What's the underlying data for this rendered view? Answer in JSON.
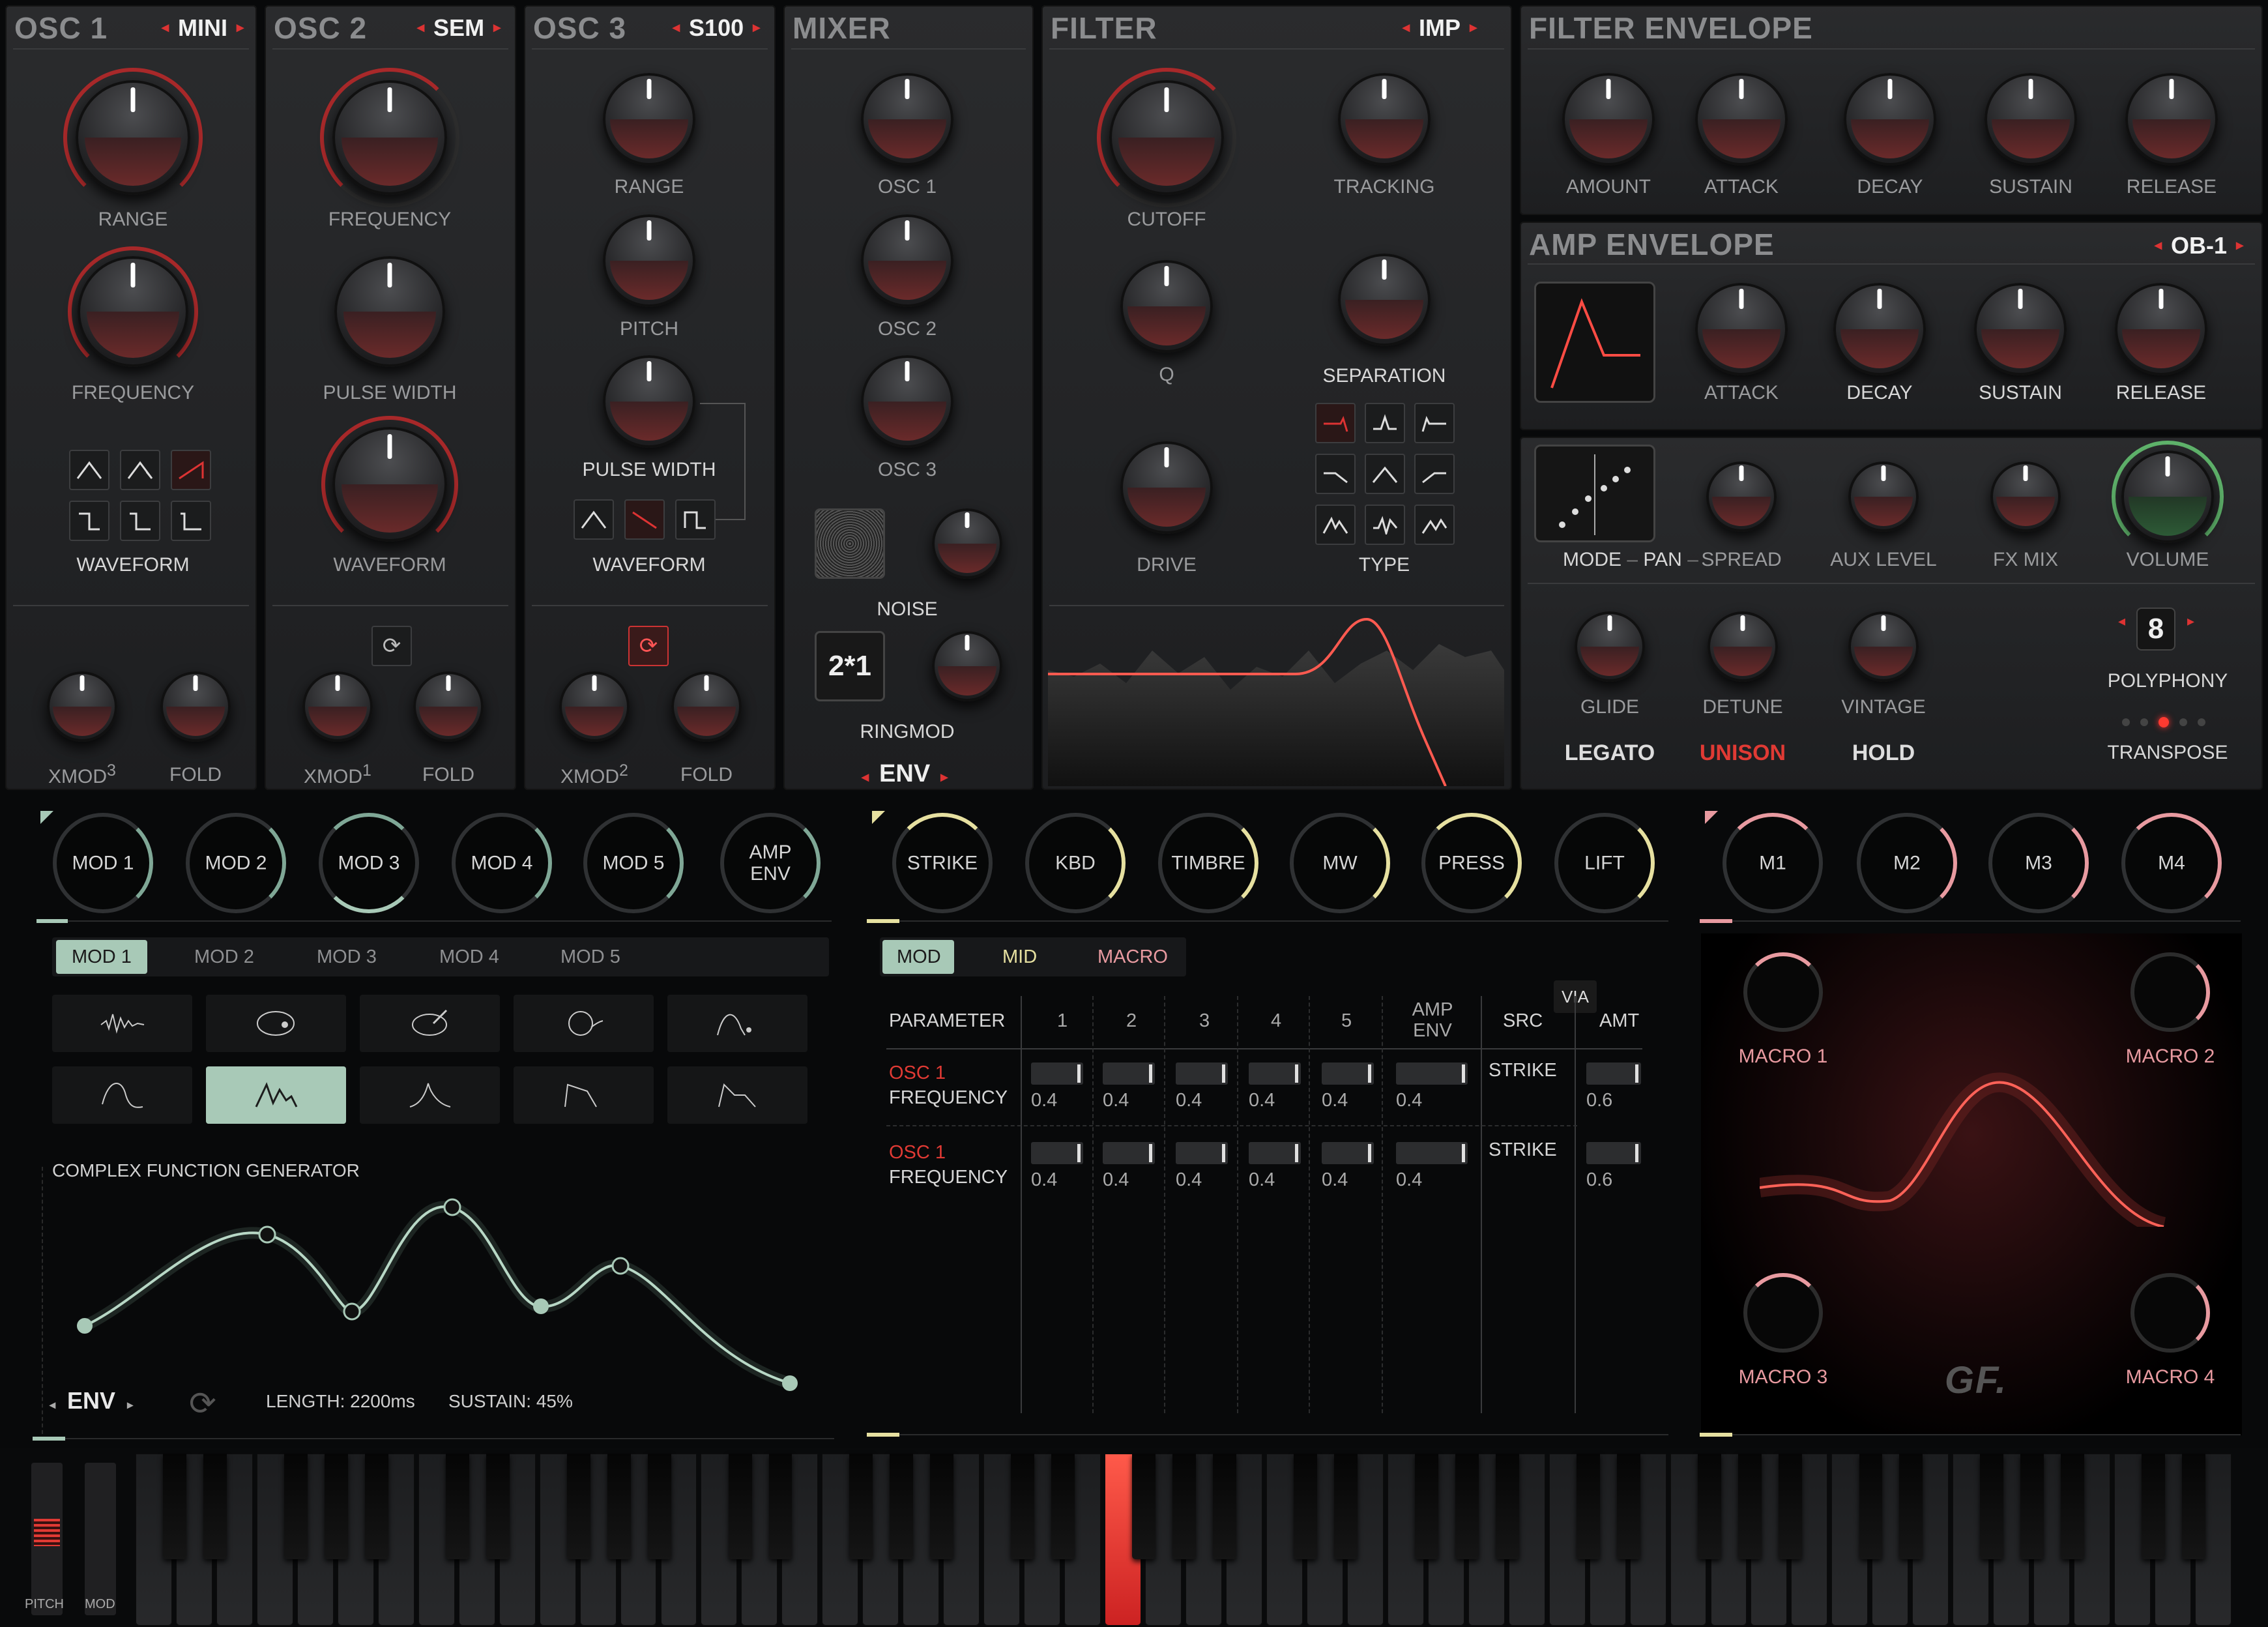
{
  "osc1": {
    "title": "OSC 1",
    "model": "MINI",
    "range": "RANGE",
    "frequency": "FREQUENCY",
    "waveform": "WAVEFORM",
    "xmod": "XMOD",
    "xmod_sup": "3",
    "fold": "FOLD"
  },
  "osc2": {
    "title": "OSC 2",
    "model": "SEM",
    "frequency": "FREQUENCY",
    "pulse_width": "PULSE WIDTH",
    "waveform": "WAVEFORM",
    "xmod": "XMOD",
    "xmod_sup": "1",
    "fold": "FOLD"
  },
  "osc3": {
    "title": "OSC 3",
    "model": "S100",
    "range": "RANGE",
    "pitch": "PITCH",
    "pulse_width": "PULSE WIDTH",
    "waveform": "WAVEFORM",
    "xmod": "XMOD",
    "xmod_sup": "2",
    "fold": "FOLD"
  },
  "mixer": {
    "title": "MIXER",
    "osc1": "OSC 1",
    "osc2": "OSC 2",
    "osc3": "OSC 3",
    "noise": "NOISE",
    "ringmod": "RINGMOD",
    "ringmod_value": "2*1",
    "env": "ENV"
  },
  "filter": {
    "title": "FILTER",
    "model": "IMP",
    "cutoff": "CUTOFF",
    "tracking": "TRACKING",
    "q": "Q",
    "separation": "SEPARATION",
    "drive": "DRIVE",
    "type": "TYPE"
  },
  "filter_env": {
    "title": "FILTER ENVELOPE",
    "labels": [
      "AMOUNT",
      "ATTACK",
      "DECAY",
      "SUSTAIN",
      "RELEASE"
    ]
  },
  "amp_env": {
    "title": "AMP ENVELOPE",
    "model": "OB-1",
    "labels": [
      "ATTACK",
      "DECAY",
      "SUSTAIN",
      "RELEASE"
    ]
  },
  "voice": {
    "mode": "MODE",
    "pan": "PAN",
    "spread": "SPREAD",
    "aux_level": "AUX LEVEL",
    "fx_mix": "FX MIX",
    "volume": "VOLUME",
    "glide": "GLIDE",
    "detune": "DETUNE",
    "vintage": "VINTAGE",
    "legato": "LEGATO",
    "unison": "UNISON",
    "hold": "HOLD",
    "polyphony_value": "8",
    "polyphony": "POLYPHONY",
    "transpose": "TRANSPOSE"
  },
  "mod_sources": {
    "knobs": [
      "MOD 1",
      "MOD 2",
      "MOD 3",
      "MOD 4",
      "MOD 5",
      "AMP ENV"
    ],
    "tabs": [
      "MOD 1",
      "MOD 2",
      "MOD 3",
      "MOD 4",
      "MOD 5"
    ],
    "generator_title": "COMPLEX FUNCTION GENERATOR",
    "env_label": "ENV",
    "length": "LENGTH: 2200ms",
    "sustain": "SUSTAIN: 45%"
  },
  "perf": {
    "knobs": [
      "STRIKE",
      "KBD",
      "TIMBRE",
      "MW",
      "PRESS",
      "LIFT"
    ],
    "tabs": [
      "MOD",
      "MID",
      "MACRO"
    ],
    "via": "VIA",
    "headers": [
      "PARAMETER",
      "1",
      "2",
      "3",
      "4",
      "5",
      "AMP ENV",
      "SRC",
      "AMT"
    ],
    "rows": [
      {
        "osc": "OSC 1",
        "param": "FREQUENCY",
        "vals": [
          "0.4",
          "0.4",
          "0.4",
          "0.4",
          "0.4",
          "0.4"
        ],
        "src": "STRIKE",
        "amt": "0.6"
      },
      {
        "osc": "OSC 1",
        "param": "FREQUENCY",
        "vals": [
          "0.4",
          "0.4",
          "0.4",
          "0.4",
          "0.4",
          "0.4"
        ],
        "src": "STRIKE",
        "amt": "0.6"
      }
    ]
  },
  "macros": {
    "knobs": [
      "M1",
      "M2",
      "M3",
      "M4"
    ],
    "labels": [
      "MACRO 1",
      "MACRO 2",
      "MACRO 3",
      "MACRO 4"
    ],
    "logo": "GF."
  },
  "keyboard": {
    "pitch": "PITCH",
    "mod": "MOD"
  },
  "colors": {
    "accent_red": "#d33a35",
    "mod_green": "#a8c9b7",
    "perf_yellow": "#e6e0a0",
    "macro_pink": "#e89aa0"
  }
}
